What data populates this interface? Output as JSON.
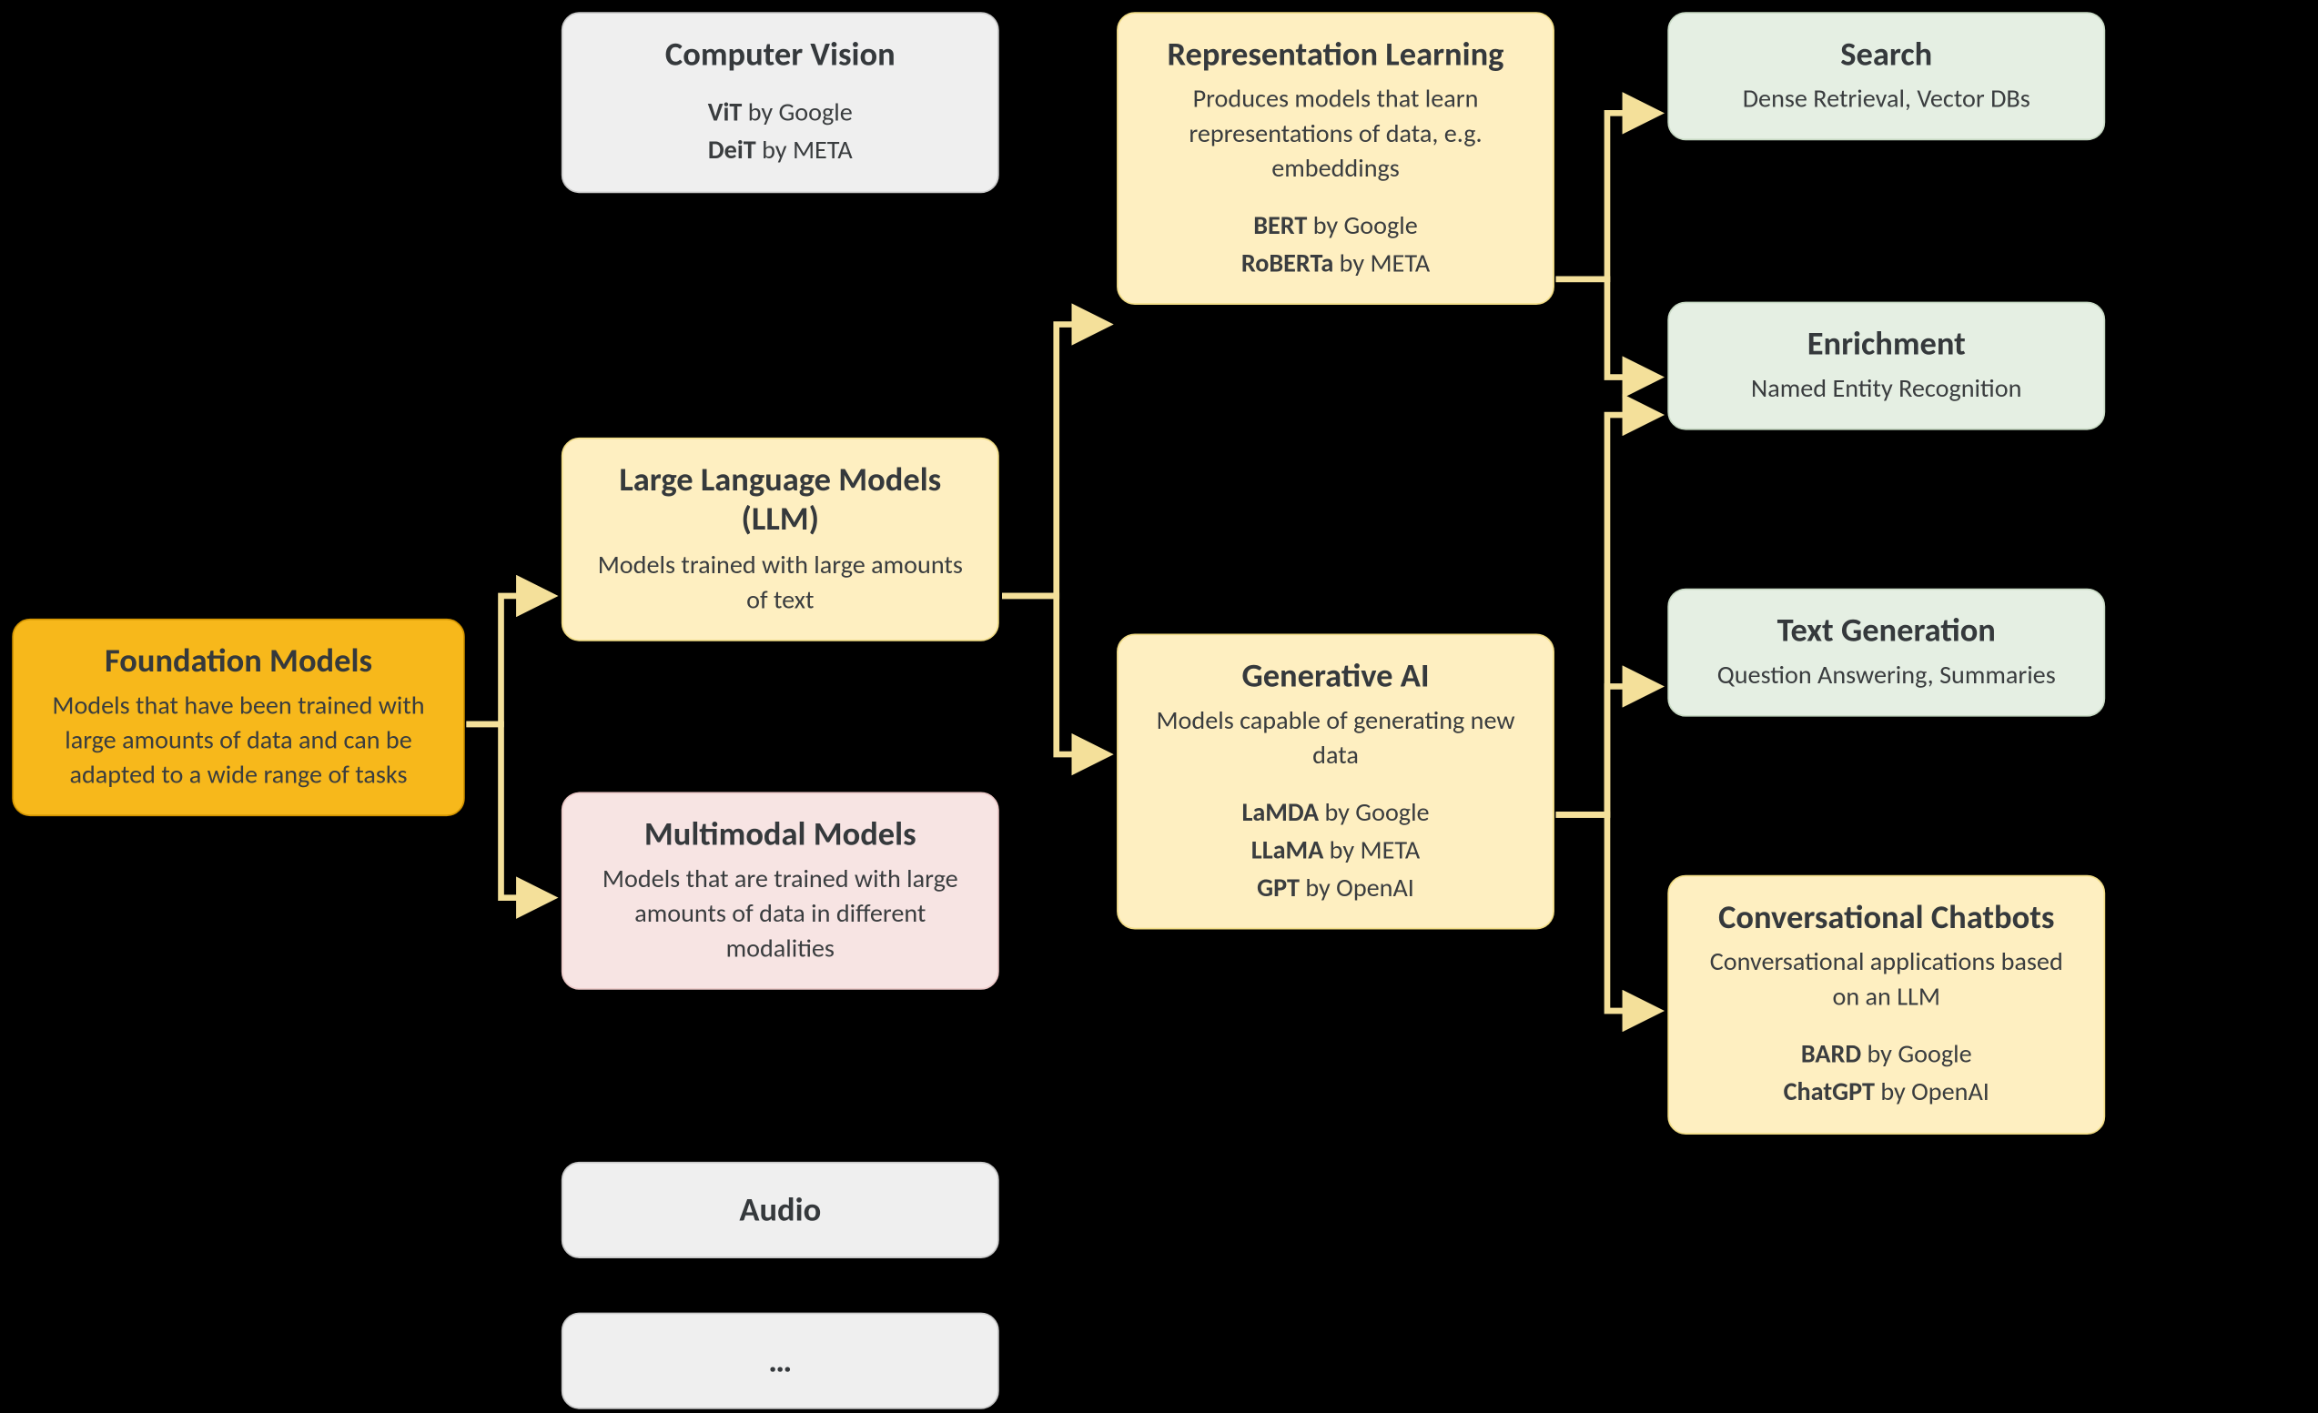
{
  "root": {
    "title": "Foundation Models",
    "desc": "Models that have been trained with large amounts of data and can be adapted to a wide range of tasks"
  },
  "cv": {
    "title": "Computer Vision",
    "ex": [
      {
        "name": "ViT",
        "by": " by Google"
      },
      {
        "name": "DeiT",
        "by": " by META"
      }
    ]
  },
  "llm": {
    "title": "Large Language Models (LLM)",
    "desc": "Models trained with large amounts of text"
  },
  "mm": {
    "title": "Multimodal Models",
    "desc": "Models that are trained with large amounts of data in different modalities"
  },
  "audio": {
    "title": "Audio"
  },
  "more": {
    "title": "…"
  },
  "repr": {
    "title": "Representation Learning",
    "desc": "Produces models that learn representations of data, e.g. embeddings",
    "ex": [
      {
        "name": "BERT",
        "by": " by Google"
      },
      {
        "name": "RoBERTa",
        "by": " by META"
      }
    ]
  },
  "gen": {
    "title": "Generative AI",
    "desc": "Models capable of generating new data",
    "ex": [
      {
        "name": "LaMDA",
        "by": " by Google"
      },
      {
        "name": "LLaMA",
        "by": " by META"
      },
      {
        "name": "GPT",
        "by": " by OpenAI"
      }
    ]
  },
  "search": {
    "title": "Search",
    "desc": "Dense Retrieval, Vector DBs"
  },
  "enrich": {
    "title": "Enrichment",
    "desc": "Named Entity Recognition"
  },
  "textgen": {
    "title": "Text Generation",
    "desc": "Question Answering, Summaries"
  },
  "chat": {
    "title": "Conversational Chatbots",
    "desc": "Conversational applications based on an LLM",
    "ex": [
      {
        "name": "BARD",
        "by": " by Google"
      },
      {
        "name": "ChatGPT",
        "by": " by OpenAI"
      }
    ]
  },
  "palette": {
    "orange": "#f7b81b",
    "gray": "#efefef",
    "yellow": "#feefc1",
    "pink": "#f7e4e3",
    "green": "#e5efe3",
    "arrow": "#f4e09a"
  }
}
